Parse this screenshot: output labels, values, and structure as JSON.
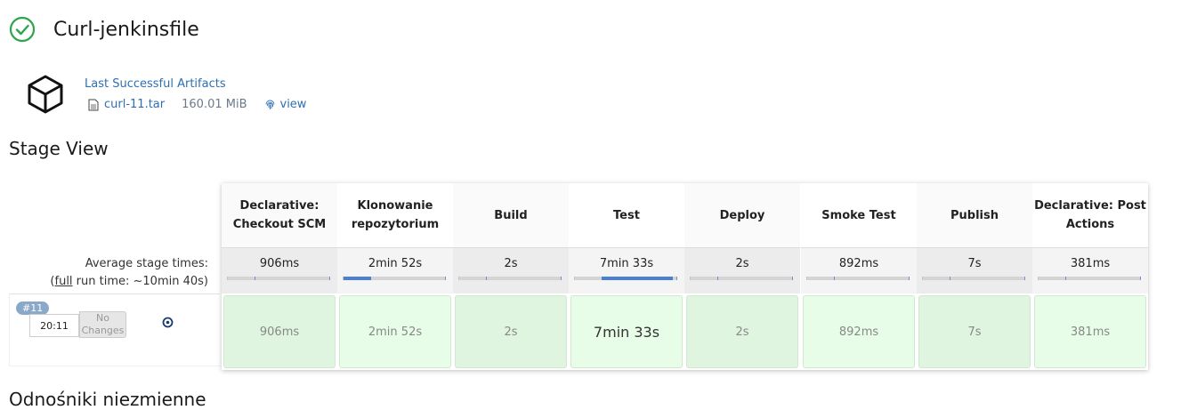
{
  "job": {
    "title": "Curl-jenkinsfile",
    "status_icon": "check-circle-icon",
    "status_color": "#2ea44f"
  },
  "artifacts": {
    "title": "Last Successful Artifacts",
    "file_name": "curl-11.tar",
    "file_size": "160.01 MiB",
    "view_label": "view"
  },
  "stage_view": {
    "heading": "Stage View",
    "average_label": "Average stage times:",
    "full_run_link": "full",
    "full_run_rest": " run time: ~10min 40s)",
    "full_run_open": "(",
    "stages": [
      {
        "name": "Declarative: Checkout SCM",
        "avg": "906ms",
        "bar_fraction": 0.01,
        "duration": "906ms",
        "slow": false
      },
      {
        "name": "Klonowanie repozytorium",
        "avg": "2min 52s",
        "bar_fraction": 0.27,
        "duration": "2min 52s",
        "slow": false
      },
      {
        "name": "Build",
        "avg": "2s",
        "bar_fraction": 0.01,
        "duration": "2s",
        "slow": false
      },
      {
        "name": "Test",
        "avg": "7min 33s",
        "bar_fraction": 0.7,
        "duration": "7min 33s",
        "slow": true
      },
      {
        "name": "Deploy",
        "avg": "2s",
        "bar_fraction": 0.01,
        "duration": "2s",
        "slow": false
      },
      {
        "name": "Smoke Test",
        "avg": "892ms",
        "bar_fraction": 0.01,
        "duration": "892ms",
        "slow": false
      },
      {
        "name": "Publish",
        "avg": "7s",
        "bar_fraction": 0.01,
        "duration": "7s",
        "slow": false
      },
      {
        "name": "Declarative: Post Actions",
        "avg": "381ms",
        "bar_fraction": 0.01,
        "duration": "381ms",
        "slow": false
      }
    ],
    "build": {
      "number": "#11",
      "time": "20:11",
      "changes": "No Changes"
    }
  },
  "next_heading": "Odnośniki niezmienne"
}
